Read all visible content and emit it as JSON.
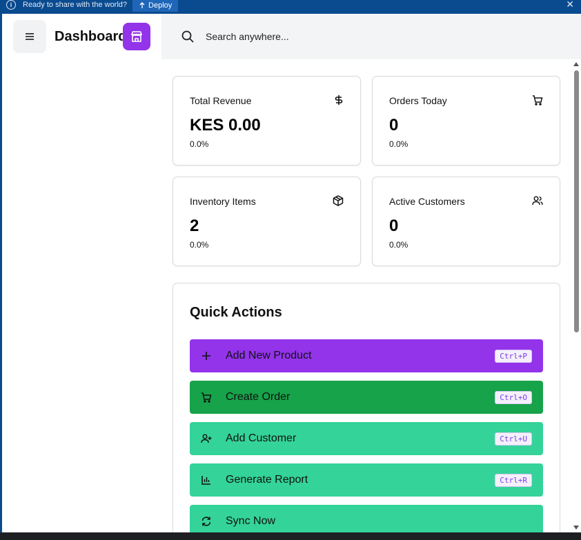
{
  "topbar": {
    "message": "Ready to share with the world?",
    "deploy_label": "Deploy",
    "close": "✕"
  },
  "sidebar": {
    "brand": "Dashboard"
  },
  "header": {
    "search_placeholder": "Search anywhere..."
  },
  "stats": [
    {
      "title": "Total Revenue",
      "value": "KES 0.00",
      "change": "0.0%",
      "icon": "dollar-icon"
    },
    {
      "title": "Orders Today",
      "value": "0",
      "change": "0.0%",
      "icon": "cart-icon"
    },
    {
      "title": "Inventory Items",
      "value": "2",
      "change": "0.0%",
      "icon": "package-icon"
    },
    {
      "title": "Active Customers",
      "value": "0",
      "change": "0.0%",
      "icon": "users-icon"
    }
  ],
  "quick_actions": {
    "title": "Quick Actions",
    "items": [
      {
        "label": "Add New Product",
        "shortcut": "Ctrl+P",
        "icon": "plus-icon",
        "color": "#9333ea"
      },
      {
        "label": "Create Order",
        "shortcut": "Ctrl+O",
        "icon": "cart-icon",
        "color": "#16a34a"
      },
      {
        "label": "Add Customer",
        "shortcut": "Ctrl+U",
        "icon": "user-plus-icon",
        "color": "#34d399"
      },
      {
        "label": "Generate Report",
        "shortcut": "Ctrl+R",
        "icon": "bar-chart-icon",
        "color": "#34d399"
      },
      {
        "label": "Sync Now",
        "shortcut": "",
        "icon": "refresh-icon",
        "color": "#34d399"
      }
    ]
  },
  "colors": {
    "topbar": "#0a4a8f",
    "brand_accent": "#9333ea",
    "header_bg": "#f3f4f6"
  }
}
